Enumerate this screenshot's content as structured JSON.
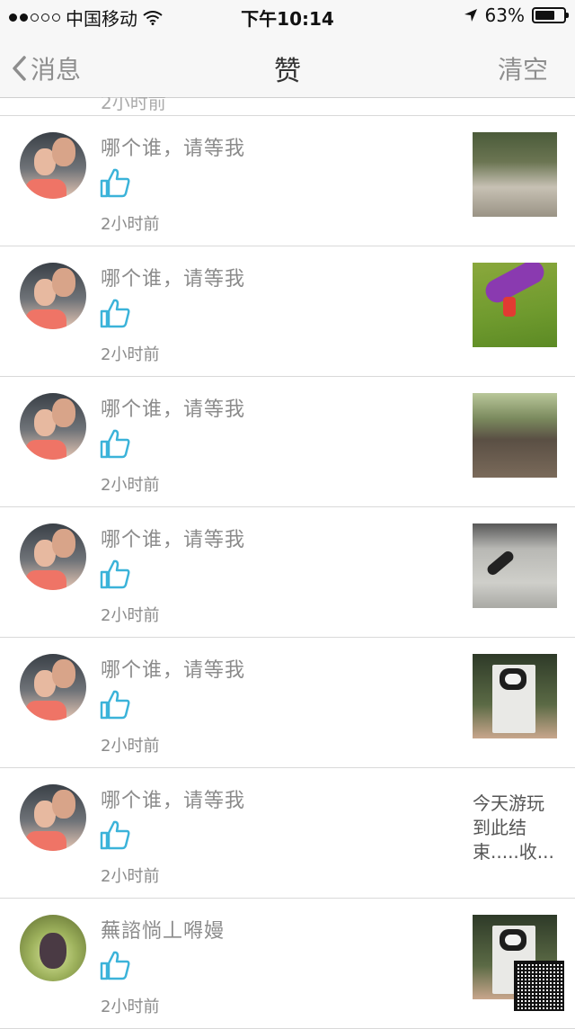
{
  "status_bar": {
    "carrier": "中国移动",
    "time": "下午10:14",
    "battery": "63%",
    "battery_level": 0.63
  },
  "nav": {
    "back_label": "消息",
    "title": "赞",
    "clear_label": "清空"
  },
  "likes": [
    {
      "name": "哪个谁，请等我",
      "time": "2小时前",
      "icon": "thumbs-up-icon",
      "thumb_type": "image"
    },
    {
      "name": "哪个谁，请等我",
      "time": "2小时前",
      "icon": "thumbs-up-icon",
      "thumb_type": "image"
    },
    {
      "name": "哪个谁，请等我",
      "time": "2小时前",
      "icon": "thumbs-up-icon",
      "thumb_type": "image"
    },
    {
      "name": "哪个谁，请等我",
      "time": "2小时前",
      "icon": "thumbs-up-icon",
      "thumb_type": "image"
    },
    {
      "name": "哪个谁，请等我",
      "time": "2小时前",
      "icon": "thumbs-up-icon",
      "thumb_type": "image"
    },
    {
      "name": "哪个谁，请等我",
      "time": "2小时前",
      "icon": "thumbs-up-icon",
      "thumb_type": "text",
      "thumb_text": "今天游玩\n到此结\n束.....收..."
    },
    {
      "name": "蕪諮惝丄嘚嫚",
      "time": "2小时前",
      "icon": "thumbs-up-icon",
      "thumb_type": "image"
    }
  ],
  "colors": {
    "like_icon": "#3bb3d9",
    "secondary_text": "#8b8b8b",
    "bar_background": "#f7f7f7"
  }
}
